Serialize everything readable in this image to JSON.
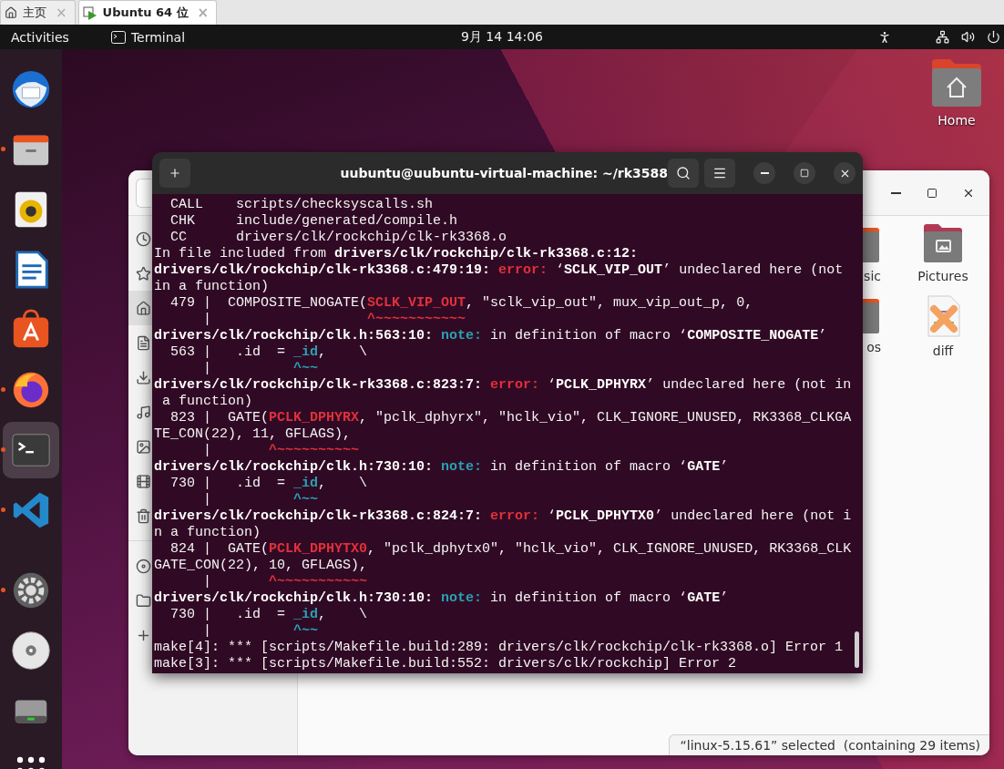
{
  "vm_tabs": [
    {
      "label": "主页",
      "selected": false,
      "close": "×"
    },
    {
      "label": "Ubuntu 64 位",
      "selected": true,
      "close": "×"
    }
  ],
  "top_bar": {
    "activities": "Activities",
    "app_menu": "Terminal",
    "clock": "9月 14 14:06"
  },
  "dock": [
    {
      "kind": "mail",
      "running": false,
      "selected": false
    },
    {
      "kind": "files",
      "running": true,
      "selected": false
    },
    {
      "kind": "music",
      "running": false,
      "selected": false
    },
    {
      "kind": "writer",
      "running": false,
      "selected": false
    },
    {
      "kind": "store",
      "running": false,
      "selected": false
    },
    {
      "kind": "browser",
      "running": true,
      "selected": false
    },
    {
      "kind": "terminal",
      "running": true,
      "selected": true
    },
    {
      "kind": "code",
      "running": true,
      "selected": false
    },
    {
      "kind": "separator"
    },
    {
      "kind": "settings",
      "running": true,
      "selected": false
    },
    {
      "kind": "disc",
      "running": false,
      "selected": false
    },
    {
      "kind": "drive",
      "running": false,
      "selected": false
    },
    {
      "kind": "apps",
      "running": false,
      "selected": false
    }
  ],
  "desktop_icons": [
    {
      "label": "Home"
    }
  ],
  "files_window": {
    "sidebar": [
      {
        "kind": "recent",
        "selected": false
      },
      {
        "kind": "starred",
        "selected": false
      },
      {
        "kind": "home",
        "selected": true
      },
      {
        "kind": "documents",
        "selected": false
      },
      {
        "kind": "downloads",
        "selected": false
      },
      {
        "kind": "music",
        "selected": false
      },
      {
        "kind": "pictures",
        "selected": false
      },
      {
        "kind": "videos",
        "selected": false
      },
      {
        "kind": "trash",
        "selected": false
      },
      {
        "kind": "separator"
      },
      {
        "kind": "disc",
        "selected": false
      },
      {
        "kind": "folder",
        "selected": false
      },
      {
        "kind": "add",
        "selected": false
      }
    ],
    "items": [
      {
        "label": "sic",
        "kind": "folder"
      },
      {
        "label": "Pictures",
        "kind": "pictures"
      },
      {
        "label": "os",
        "kind": "folder"
      },
      {
        "label": "diff",
        "kind": "file"
      }
    ],
    "status": "“linux-5.15.61” selected  (containing 29 items)"
  },
  "terminal": {
    "title": "uubuntu@uubuntu-virtual-machine: ~/rk3588",
    "lines": [
      [
        {
          "kind": "plain",
          "t": "  CALL    scripts/checksyscalls.sh"
        }
      ],
      [
        {
          "kind": "plain",
          "t": "  CHK     include/generated/compile.h"
        }
      ],
      [
        {
          "kind": "plain",
          "t": "  CC      drivers/clk/rockchip/clk-rk3368.o"
        }
      ],
      [
        {
          "kind": "plain",
          "t": "In file included from "
        },
        {
          "kind": "bold",
          "t": "drivers/clk/rockchip/clk-rk3368.c:12:"
        }
      ],
      [
        {
          "kind": "bold",
          "t": "drivers/clk/rockchip/clk-rk3368.c:479:19: "
        },
        {
          "kind": "error",
          "t": "error: "
        },
        {
          "kind": "plain",
          "t": "‘"
        },
        {
          "kind": "bold",
          "t": "SCLK_VIP_OUT"
        },
        {
          "kind": "plain",
          "t": "’ undeclared here (not"
        }
      ],
      [
        {
          "kind": "plain",
          "t": "in a function)"
        }
      ],
      [
        {
          "kind": "plain",
          "t": "  479 |  COMPOSITE_NOGATE("
        },
        {
          "kind": "error",
          "t": "SCLK_VIP_OUT"
        },
        {
          "kind": "plain",
          "t": ", \"sclk_vip_out\", mux_vip_out_p, 0,"
        }
      ],
      [
        {
          "kind": "plain",
          "t": "      |                   "
        },
        {
          "kind": "error",
          "t": "^~~~~~~~~~~~"
        }
      ],
      [
        {
          "kind": "bold",
          "t": "drivers/clk/rockchip/clk.h:563:10: "
        },
        {
          "kind": "note",
          "t": "note: "
        },
        {
          "kind": "plain",
          "t": "in definition of macro ‘"
        },
        {
          "kind": "bold",
          "t": "COMPOSITE_NOGATE"
        },
        {
          "kind": "plain",
          "t": "’"
        }
      ],
      [
        {
          "kind": "plain",
          "t": "  563 |   .id  = "
        },
        {
          "kind": "note",
          "t": "_id"
        },
        {
          "kind": "plain",
          "t": ",    \\"
        }
      ],
      [
        {
          "kind": "plain",
          "t": "      |          "
        },
        {
          "kind": "note",
          "t": "^~~"
        }
      ],
      [
        {
          "kind": "bold",
          "t": "drivers/clk/rockchip/clk-rk3368.c:823:7: "
        },
        {
          "kind": "error",
          "t": "error: "
        },
        {
          "kind": "plain",
          "t": "‘"
        },
        {
          "kind": "bold",
          "t": "PCLK_DPHYRX"
        },
        {
          "kind": "plain",
          "t": "’ undeclared here (not in"
        }
      ],
      [
        {
          "kind": "plain",
          "t": " a function)"
        }
      ],
      [
        {
          "kind": "plain",
          "t": "  823 |  GATE("
        },
        {
          "kind": "error",
          "t": "PCLK_DPHYRX"
        },
        {
          "kind": "plain",
          "t": ", \"pclk_dphyrx\", \"hclk_vio\", CLK_IGNORE_UNUSED, RK3368_CLKGA"
        }
      ],
      [
        {
          "kind": "plain",
          "t": "TE_CON(22), 11, GFLAGS),"
        }
      ],
      [
        {
          "kind": "plain",
          "t": "      |       "
        },
        {
          "kind": "error",
          "t": "^~~~~~~~~~~"
        }
      ],
      [
        {
          "kind": "bold",
          "t": "drivers/clk/rockchip/clk.h:730:10: "
        },
        {
          "kind": "note",
          "t": "note: "
        },
        {
          "kind": "plain",
          "t": "in definition of macro ‘"
        },
        {
          "kind": "bold",
          "t": "GATE"
        },
        {
          "kind": "plain",
          "t": "’"
        }
      ],
      [
        {
          "kind": "plain",
          "t": "  730 |   .id  = "
        },
        {
          "kind": "note",
          "t": "_id"
        },
        {
          "kind": "plain",
          "t": ",    \\"
        }
      ],
      [
        {
          "kind": "plain",
          "t": "      |          "
        },
        {
          "kind": "note",
          "t": "^~~"
        }
      ],
      [
        {
          "kind": "bold",
          "t": "drivers/clk/rockchip/clk-rk3368.c:824:7: "
        },
        {
          "kind": "error",
          "t": "error: "
        },
        {
          "kind": "plain",
          "t": "‘"
        },
        {
          "kind": "bold",
          "t": "PCLK_DPHYTX0"
        },
        {
          "kind": "plain",
          "t": "’ undeclared here (not i"
        }
      ],
      [
        {
          "kind": "plain",
          "t": "n a function)"
        }
      ],
      [
        {
          "kind": "plain",
          "t": "  824 |  GATE("
        },
        {
          "kind": "error",
          "t": "PCLK_DPHYTX0"
        },
        {
          "kind": "plain",
          "t": ", \"pclk_dphytx0\", \"hclk_vio\", CLK_IGNORE_UNUSED, RK3368_CLK"
        }
      ],
      [
        {
          "kind": "plain",
          "t": "GATE_CON(22), 10, GFLAGS),"
        }
      ],
      [
        {
          "kind": "plain",
          "t": "      |       "
        },
        {
          "kind": "error",
          "t": "^~~~~~~~~~~~"
        }
      ],
      [
        {
          "kind": "bold",
          "t": "drivers/clk/rockchip/clk.h:730:10: "
        },
        {
          "kind": "note",
          "t": "note: "
        },
        {
          "kind": "plain",
          "t": "in definition of macro ‘"
        },
        {
          "kind": "bold",
          "t": "GATE"
        },
        {
          "kind": "plain",
          "t": "’"
        }
      ],
      [
        {
          "kind": "plain",
          "t": "  730 |   .id  = "
        },
        {
          "kind": "note",
          "t": "_id"
        },
        {
          "kind": "plain",
          "t": ",    \\"
        }
      ],
      [
        {
          "kind": "plain",
          "t": "      |          "
        },
        {
          "kind": "note",
          "t": "^~~"
        }
      ],
      [
        {
          "kind": "plain",
          "t": "make[4]: *** [scripts/Makefile.build:289: drivers/clk/rockchip/clk-rk3368.o] Error 1"
        }
      ],
      [
        {
          "kind": "plain",
          "t": "make[3]: *** [scripts/Makefile.build:552: drivers/clk/rockchip] Error 2"
        }
      ]
    ]
  }
}
